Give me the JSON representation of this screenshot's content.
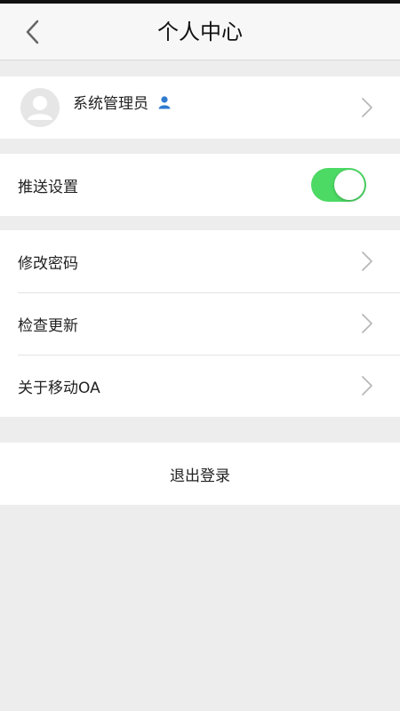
{
  "header": {
    "title": "个人中心"
  },
  "profile": {
    "name": "系统管理员",
    "badge_icon": "user-icon",
    "badge_color": "#2e7bd1"
  },
  "push": {
    "label": "推送设置",
    "enabled": true,
    "on_color": "#4cd964"
  },
  "menu": {
    "items": [
      {
        "label": "修改密码"
      },
      {
        "label": "检查更新"
      },
      {
        "label": "关于移动OA"
      }
    ]
  },
  "logout": {
    "label": "退出登录"
  }
}
